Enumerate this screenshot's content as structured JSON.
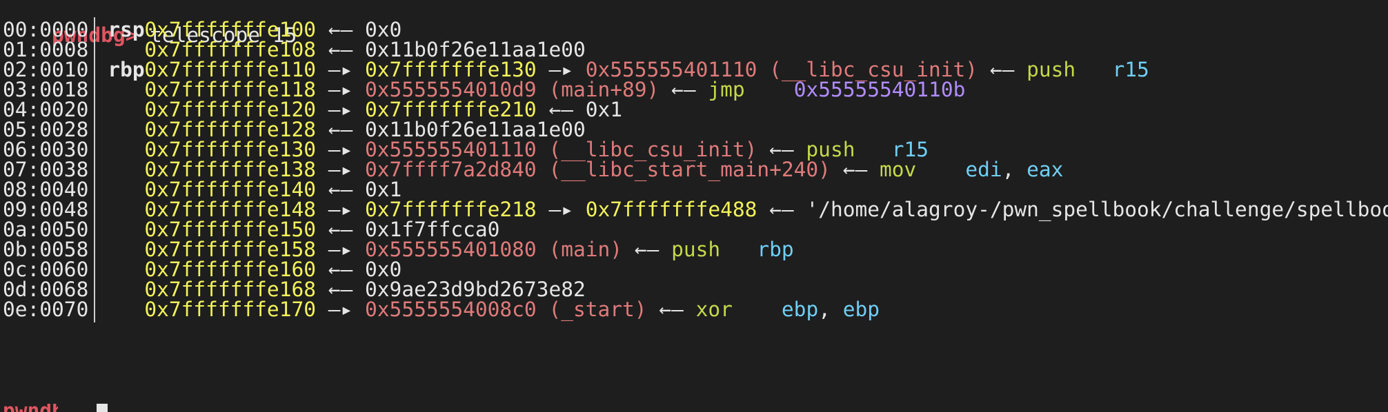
{
  "prompt": "pwndbg>",
  "command": "telescope 15",
  "rows": [
    {
      "offset": "00:0000",
      "reg": "rsp",
      "addr": "0x7fffffffe100",
      "tail": [
        {
          "t": "arrow-left",
          "v": " ←– "
        },
        {
          "t": "val",
          "v": "0x0"
        }
      ]
    },
    {
      "offset": "01:0008",
      "reg": "",
      "addr": "0x7fffffffe108",
      "tail": [
        {
          "t": "arrow-left",
          "v": " ←– "
        },
        {
          "t": "val",
          "v": "0x11b0f26e11aa1e00"
        }
      ]
    },
    {
      "offset": "02:0010",
      "reg": "rbp",
      "addr": "0x7fffffffe110",
      "tail": [
        {
          "t": "arrow",
          "v": " –▸ "
        },
        {
          "t": "stk",
          "v": "0x7fffffffe130"
        },
        {
          "t": "arrow",
          "v": " –▸ "
        },
        {
          "t": "code",
          "v": "0x555555401110 (__libc_csu_init)"
        },
        {
          "t": "arrow-left",
          "v": " ←– "
        },
        {
          "t": "ins",
          "v": "push"
        },
        {
          "t": "sp",
          "v": "   "
        },
        {
          "t": "opr",
          "v": "r15"
        }
      ]
    },
    {
      "offset": "03:0018",
      "reg": "",
      "addr": "0x7fffffffe118",
      "tail": [
        {
          "t": "arrow",
          "v": " –▸ "
        },
        {
          "t": "code",
          "v": "0x5555554010d9 (main+89)"
        },
        {
          "t": "arrow-left",
          "v": " ←– "
        },
        {
          "t": "ins",
          "v": "jmp"
        },
        {
          "t": "sp",
          "v": "    "
        },
        {
          "t": "addr",
          "v": "0x55555540110b"
        }
      ]
    },
    {
      "offset": "04:0020",
      "reg": "",
      "addr": "0x7fffffffe120",
      "tail": [
        {
          "t": "arrow",
          "v": " –▸ "
        },
        {
          "t": "stk",
          "v": "0x7fffffffe210"
        },
        {
          "t": "arrow-left",
          "v": " ←– "
        },
        {
          "t": "val",
          "v": "0x1"
        }
      ]
    },
    {
      "offset": "05:0028",
      "reg": "",
      "addr": "0x7fffffffe128",
      "tail": [
        {
          "t": "arrow-left",
          "v": " ←– "
        },
        {
          "t": "val",
          "v": "0x11b0f26e11aa1e00"
        }
      ]
    },
    {
      "offset": "06:0030",
      "reg": "",
      "addr": "0x7fffffffe130",
      "tail": [
        {
          "t": "arrow",
          "v": " –▸ "
        },
        {
          "t": "code",
          "v": "0x555555401110 (__libc_csu_init)"
        },
        {
          "t": "arrow-left",
          "v": " ←– "
        },
        {
          "t": "ins",
          "v": "push"
        },
        {
          "t": "sp",
          "v": "   "
        },
        {
          "t": "opr",
          "v": "r15"
        }
      ]
    },
    {
      "offset": "07:0038",
      "reg": "",
      "addr": "0x7fffffffe138",
      "tail": [
        {
          "t": "arrow",
          "v": " –▸ "
        },
        {
          "t": "code",
          "v": "0x7ffff7a2d840 (__libc_start_main+240)"
        },
        {
          "t": "arrow-left",
          "v": " ←– "
        },
        {
          "t": "ins",
          "v": "mov"
        },
        {
          "t": "sp",
          "v": "    "
        },
        {
          "t": "opr",
          "v": "edi"
        },
        {
          "t": "val",
          "v": ", "
        },
        {
          "t": "opr",
          "v": "eax"
        }
      ]
    },
    {
      "offset": "08:0040",
      "reg": "",
      "addr": "0x7fffffffe140",
      "tail": [
        {
          "t": "arrow-left",
          "v": " ←– "
        },
        {
          "t": "val",
          "v": "0x1"
        }
      ]
    },
    {
      "offset": "09:0048",
      "reg": "",
      "addr": "0x7fffffffe148",
      "tail": [
        {
          "t": "arrow",
          "v": " –▸ "
        },
        {
          "t": "stk",
          "v": "0x7fffffffe218"
        },
        {
          "t": "arrow",
          "v": " –▸ "
        },
        {
          "t": "stk",
          "v": "0x7fffffffe488"
        },
        {
          "t": "arrow-left",
          "v": " ←– "
        },
        {
          "t": "str",
          "v": "'/home/alagroy-/pwn_spellbook/challenge/spellbook'"
        }
      ]
    },
    {
      "offset": "0a:0050",
      "reg": "",
      "addr": "0x7fffffffe150",
      "tail": [
        {
          "t": "arrow-left",
          "v": " ←– "
        },
        {
          "t": "val",
          "v": "0x1f7ffcca0"
        }
      ]
    },
    {
      "offset": "0b:0058",
      "reg": "",
      "addr": "0x7fffffffe158",
      "tail": [
        {
          "t": "arrow",
          "v": " –▸ "
        },
        {
          "t": "code",
          "v": "0x555555401080 (main)"
        },
        {
          "t": "arrow-left",
          "v": " ←– "
        },
        {
          "t": "ins",
          "v": "push"
        },
        {
          "t": "sp",
          "v": "   "
        },
        {
          "t": "opr",
          "v": "rbp"
        }
      ]
    },
    {
      "offset": "0c:0060",
      "reg": "",
      "addr": "0x7fffffffe160",
      "tail": [
        {
          "t": "arrow-left",
          "v": " ←– "
        },
        {
          "t": "val",
          "v": "0x0"
        }
      ]
    },
    {
      "offset": "0d:0068",
      "reg": "",
      "addr": "0x7fffffffe168",
      "tail": [
        {
          "t": "arrow-left",
          "v": " ←– "
        },
        {
          "t": "val",
          "v": "0x9ae23d9bd2673e82"
        }
      ]
    },
    {
      "offset": "0e:0070",
      "reg": "",
      "addr": "0x7fffffffe170",
      "tail": [
        {
          "t": "arrow",
          "v": " –▸ "
        },
        {
          "t": "code",
          "v": "0x5555554008c0 (_start)"
        },
        {
          "t": "arrow-left",
          "v": " ←– "
        },
        {
          "t": "ins",
          "v": "xor"
        },
        {
          "t": "sp",
          "v": "    "
        },
        {
          "t": "opr",
          "v": "ebp"
        },
        {
          "t": "val",
          "v": ", "
        },
        {
          "t": "opr",
          "v": "ebp"
        }
      ]
    }
  ],
  "colors": {
    "background": "#1e1e1e",
    "prompt": "#e05561",
    "stack_addr": "#f2f25a",
    "code_addr": "#e07a7a",
    "instruction": "#c5d84a",
    "operand": "#6fcff5",
    "jump_target": "#b18cff"
  }
}
